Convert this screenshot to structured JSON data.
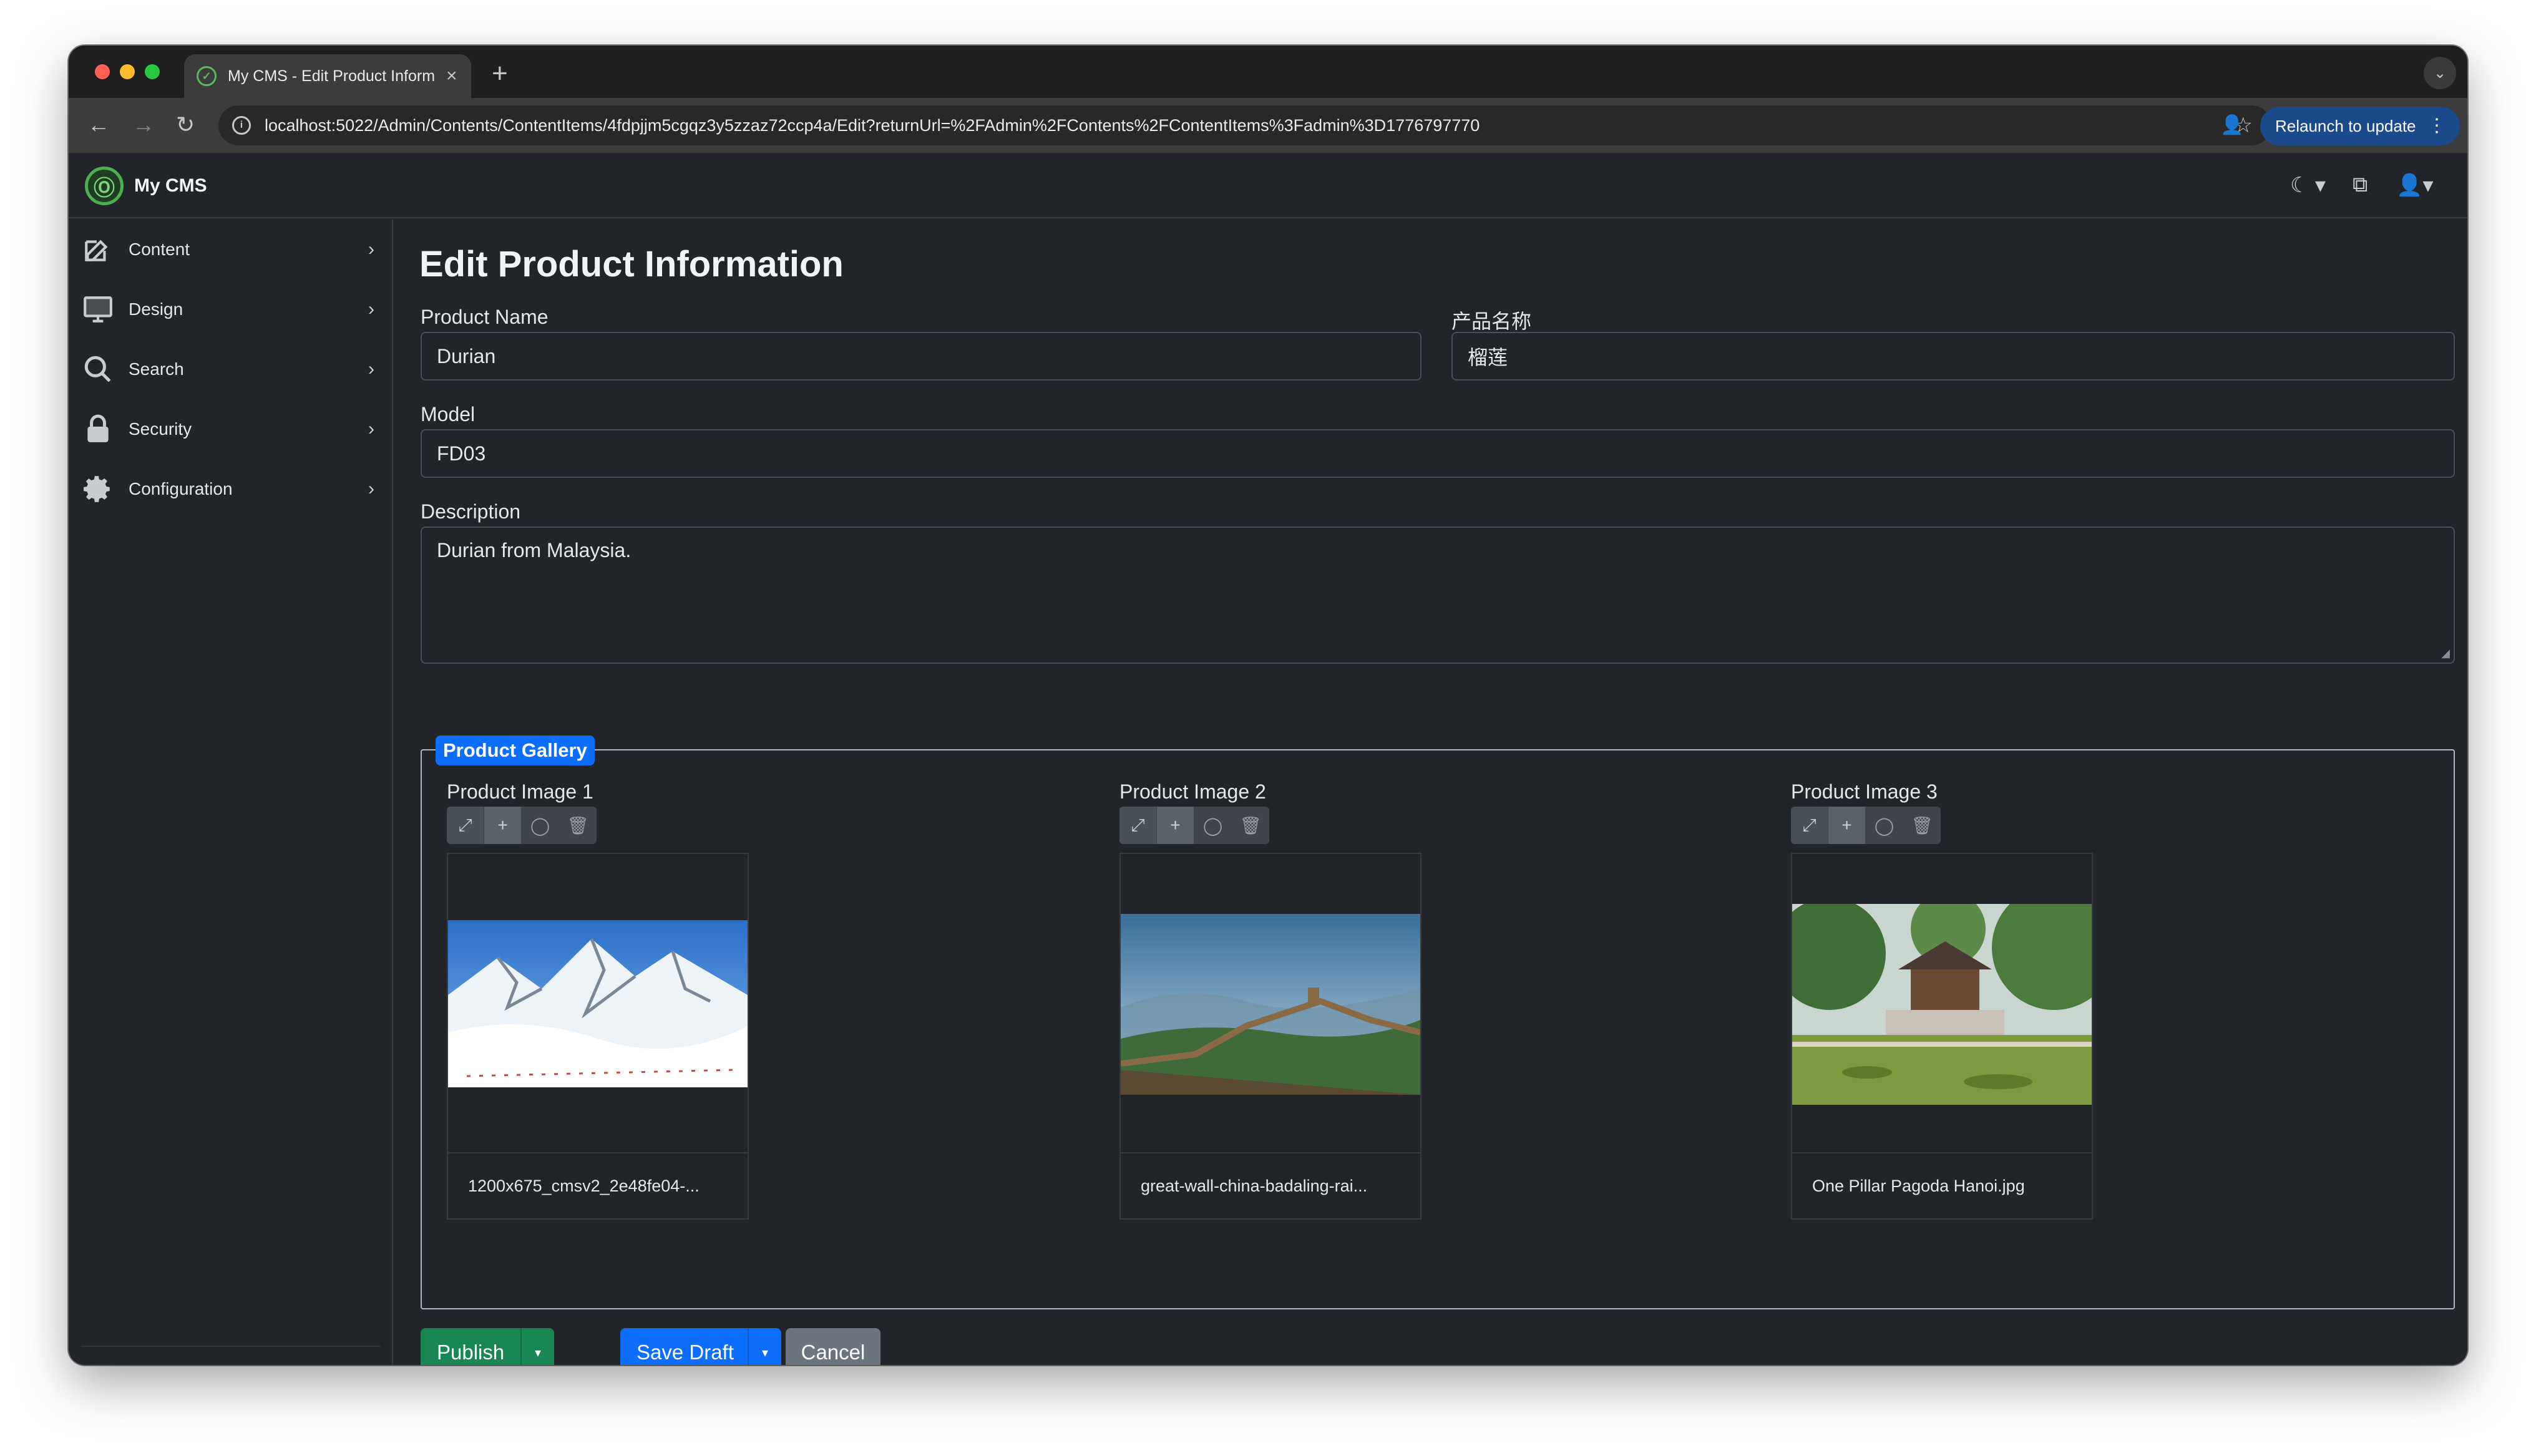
{
  "browser": {
    "tab_title": "My CMS - Edit Product Inform",
    "tab_close": "×",
    "new_tab": "+",
    "url": "localhost:5022/Admin/Contents/ContentItems/4fdpjjm5cgqz3y5zzaz72ccp4a/Edit?returnUrl=%2FAdmin%2FContents%2FContentItems%3Fadmin%3D1776797770",
    "relaunch_label": "Relaunch to update",
    "relaunch_menu": "⋮"
  },
  "app": {
    "brand": "My CMS"
  },
  "sidebar": {
    "items": [
      {
        "label": "Content",
        "icon": "edit-icon"
      },
      {
        "label": "Design",
        "icon": "monitor-icon"
      },
      {
        "label": "Search",
        "icon": "search-icon"
      },
      {
        "label": "Security",
        "icon": "lock-icon"
      },
      {
        "label": "Configuration",
        "icon": "gear-icon"
      }
    ],
    "collapse_glyph": "«"
  },
  "form": {
    "title": "Edit Product Information",
    "product_name_label": "Product Name",
    "product_name_value": "Durian",
    "product_name_cn_label": "产品名称",
    "product_name_cn_value": "榴莲",
    "model_label": "Model",
    "model_value": "FD03",
    "description_label": "Description",
    "description_value": "Durian from Malaysia."
  },
  "gallery": {
    "legend": "Product Gallery",
    "images": [
      {
        "label": "Product Image 1",
        "caption": "1200x675_cmsv2_2e48fe04-..."
      },
      {
        "label": "Product Image 2",
        "caption": "great-wall-china-badaling-rai..."
      },
      {
        "label": "Product Image 3",
        "caption": "One Pillar Pagoda Hanoi.jpg"
      }
    ]
  },
  "actions": {
    "publish": "Publish",
    "save_draft": "Save Draft",
    "cancel": "Cancel"
  }
}
